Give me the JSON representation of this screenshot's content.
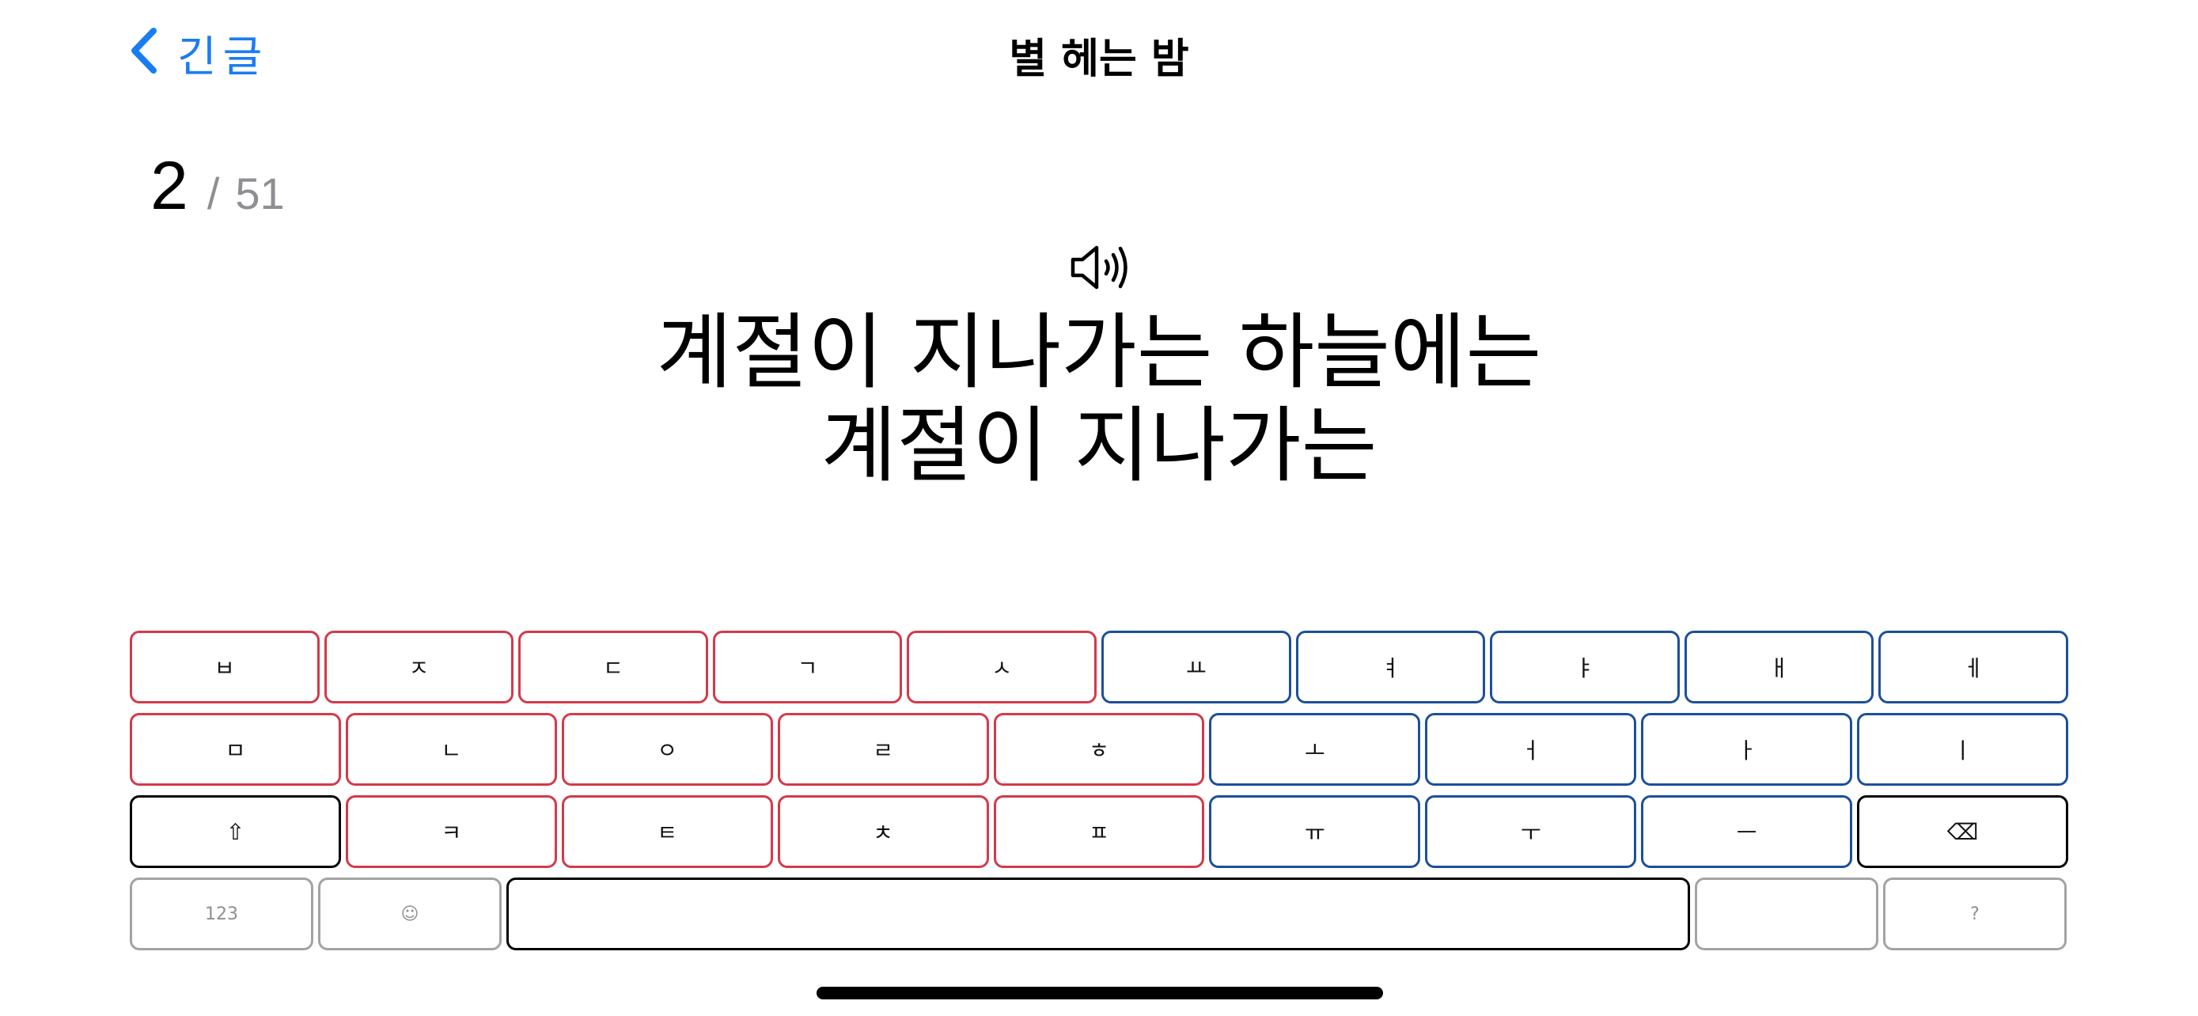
{
  "nav": {
    "back_label": "긴글",
    "title": "별 헤는 밤"
  },
  "progress": {
    "current": "2",
    "separator": "/",
    "total": "51"
  },
  "prompt": {
    "lines": [
      "계절이 지나가는 하늘에는",
      "계절이 지나가는"
    ]
  },
  "keyboard": {
    "rows": [
      [
        {
          "label": "ㅂ",
          "kind": "consonant"
        },
        {
          "label": "ㅈ",
          "kind": "consonant"
        },
        {
          "label": "ㄷ",
          "kind": "consonant"
        },
        {
          "label": "ㄱ",
          "kind": "consonant"
        },
        {
          "label": "ㅅ",
          "kind": "consonant"
        },
        {
          "label": "ㅛ",
          "kind": "vowel"
        },
        {
          "label": "ㅕ",
          "kind": "vowel"
        },
        {
          "label": "ㅑ",
          "kind": "vowel"
        },
        {
          "label": "ㅐ",
          "kind": "vowel"
        },
        {
          "label": "ㅔ",
          "kind": "vowel"
        }
      ],
      [
        {
          "label": "ㅁ",
          "kind": "consonant"
        },
        {
          "label": "ㄴ",
          "kind": "consonant"
        },
        {
          "label": "ㅇ",
          "kind": "consonant"
        },
        {
          "label": "ㄹ",
          "kind": "consonant"
        },
        {
          "label": "ㅎ",
          "kind": "consonant"
        },
        {
          "label": "ㅗ",
          "kind": "vowel"
        },
        {
          "label": "ㅓ",
          "kind": "vowel"
        },
        {
          "label": "ㅏ",
          "kind": "vowel"
        },
        {
          "label": "ㅣ",
          "kind": "vowel"
        }
      ],
      [
        {
          "label": "⇧",
          "kind": "special",
          "name": "shift-key"
        },
        {
          "label": "ㅋ",
          "kind": "consonant"
        },
        {
          "label": "ㅌ",
          "kind": "consonant"
        },
        {
          "label": "ㅊ",
          "kind": "consonant"
        },
        {
          "label": "ㅍ",
          "kind": "consonant"
        },
        {
          "label": "ㅠ",
          "kind": "vowel"
        },
        {
          "label": "ㅜ",
          "kind": "vowel"
        },
        {
          "label": "ㅡ",
          "kind": "vowel"
        },
        {
          "label": "⌫",
          "kind": "special",
          "name": "backspace-key"
        }
      ],
      [
        {
          "label": "123",
          "kind": "gray",
          "name": "numbers-key"
        },
        {
          "label": "☺",
          "kind": "gray",
          "name": "emoji-key"
        },
        {
          "label": "",
          "kind": "special",
          "name": "space-bar"
        },
        {
          "label": "",
          "kind": "gray",
          "name": "empty-key"
        },
        {
          "label": "?",
          "kind": "gray",
          "name": "question-key"
        }
      ]
    ]
  },
  "icons": {
    "back": "chevron-left-icon",
    "audio": "speaker-wave-icon"
  },
  "colors": {
    "accent": "#1a7cf2",
    "consonant_border": "#d33a4a",
    "vowel_border": "#1c4f9e"
  }
}
